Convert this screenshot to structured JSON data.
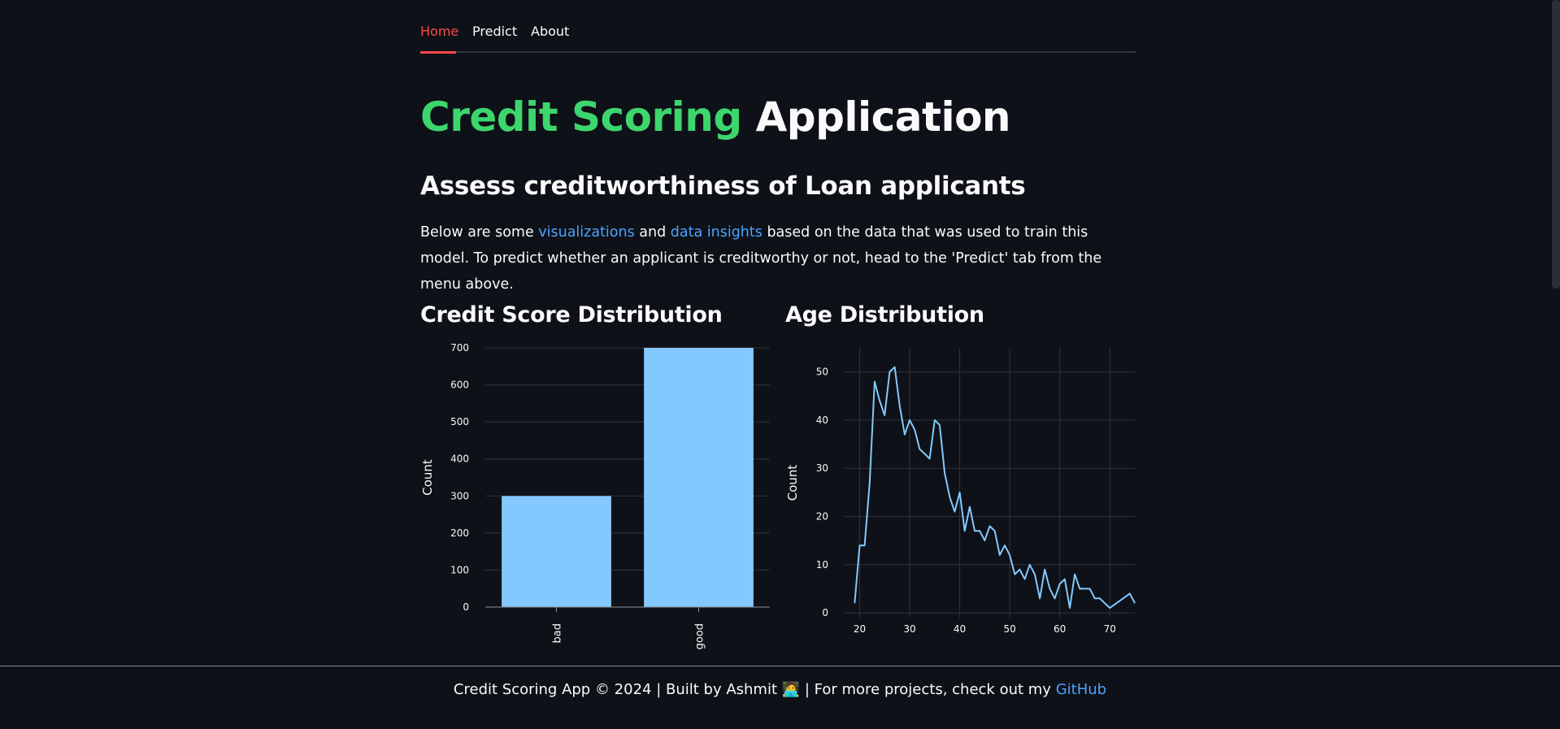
{
  "tabs": [
    {
      "label": "Home",
      "active": true
    },
    {
      "label": "Predict",
      "active": false
    },
    {
      "label": "About",
      "active": false
    }
  ],
  "title": {
    "highlight": "Credit Scoring",
    "rest": "Application"
  },
  "subtitle": "Assess creditworthiness of Loan applicants",
  "intro": {
    "part1": "Below are some ",
    "link1": "visualizations",
    "part2": " and ",
    "link2": "data insights",
    "part3": " based on the data that was used to train this model. To predict whether an applicant is creditworthy or not, head to the 'Predict' tab from the menu above."
  },
  "charts": {
    "credit_title": "Credit Score Distribution",
    "age_title": "Age Distribution"
  },
  "chart_data": [
    {
      "type": "bar",
      "categories": [
        "bad",
        "good"
      ],
      "values": [
        300,
        700
      ],
      "ylabel": "Count",
      "xlabel": "",
      "ylim": [
        0,
        700
      ],
      "yticks": [
        0,
        100,
        200,
        300,
        400,
        500,
        600,
        700
      ],
      "color": "#83c9ff",
      "grid": true
    },
    {
      "type": "line",
      "x": [
        19,
        20,
        21,
        22,
        23,
        24,
        25,
        26,
        27,
        28,
        29,
        30,
        31,
        32,
        33,
        34,
        35,
        36,
        37,
        38,
        39,
        40,
        41,
        42,
        43,
        44,
        45,
        46,
        47,
        48,
        49,
        50,
        51,
        52,
        53,
        54,
        55,
        56,
        57,
        58,
        59,
        60,
        61,
        62,
        63,
        64,
        65,
        66,
        67,
        68,
        70,
        74,
        75
      ],
      "y": [
        2,
        14,
        14,
        27,
        48,
        44,
        41,
        50,
        51,
        43,
        37,
        40,
        38,
        34,
        33,
        32,
        40,
        39,
        29,
        24,
        21,
        25,
        17,
        22,
        17,
        17,
        15,
        18,
        17,
        12,
        14,
        12,
        8,
        9,
        7,
        10,
        8,
        3,
        9,
        5,
        3,
        6,
        7,
        1,
        8,
        5,
        5,
        5,
        3,
        3,
        1,
        4,
        2
      ],
      "ylabel": "Count",
      "xlabel": "",
      "xlim": [
        17,
        75
      ],
      "ylim": [
        -1,
        55
      ],
      "xticks": [
        20,
        30,
        40,
        50,
        60,
        70
      ],
      "yticks": [
        0,
        10,
        20,
        30,
        40,
        50
      ],
      "color": "#83c9ff",
      "grid": true
    }
  ],
  "footer": {
    "text": "Credit Scoring App © 2024 | Built by Ashmit 🧑‍💻 | For more projects, check out my ",
    "link": "GitHub"
  },
  "colors": {
    "background": "#0e1117",
    "accent_red": "#ff4b4b",
    "accent_green": "#3dd56d",
    "link_blue": "#4ba3ff",
    "bar_blue": "#83c9ff"
  }
}
